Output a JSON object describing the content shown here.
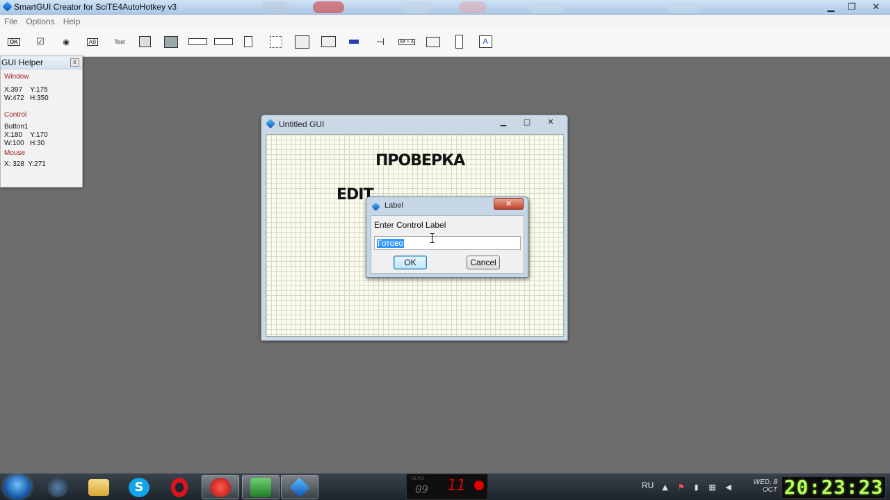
{
  "app": {
    "title": "SmartGUI Creator for SciTE4AutoHotkey v3"
  },
  "menu": [
    "File",
    "Options",
    "Help"
  ],
  "toolbar": {
    "button_tool": "OK",
    "text_tool": "Text",
    "edit_tool": "AB",
    "hotkey_tool": "Alt + A"
  },
  "helper": {
    "title": "GUI Helper",
    "window_label": "Window",
    "window_line1": "X:397    Y:175",
    "window_line2": "W:472   H:350",
    "control_label": "Control",
    "control_name": "Button1",
    "control_line1": "X:180    Y:170",
    "control_line2": "W:100   H:30",
    "mouse_label": "Mouse",
    "mouse_line": "X: 328  Y:271"
  },
  "gui": {
    "title": "Untitled GUI",
    "label1": "ПРОВЕРКА",
    "label2": "EDIT"
  },
  "dialog": {
    "title": "Label",
    "prompt": "Enter Control Label",
    "value": "Готово",
    "ok": "OK",
    "cancel": "Cancel"
  },
  "taskbar": {
    "widget_label": "AERO",
    "widget_left": "09",
    "widget_right": "11",
    "lang": "RU",
    "date_line1": "WED, 8",
    "date_line2": "OCT",
    "time": "20:23:23"
  }
}
